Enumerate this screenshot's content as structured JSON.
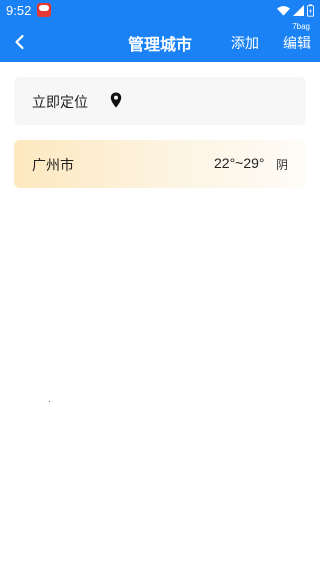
{
  "status_bar": {
    "time": "9:52"
  },
  "badge": "7bag",
  "header": {
    "title": "管理城市",
    "add_label": "添加",
    "edit_label": "编辑"
  },
  "locate": {
    "label": "立即定位"
  },
  "cities": [
    {
      "name": "广州市",
      "temp": "22°~29°",
      "weather": "阴"
    }
  ],
  "colors": {
    "header_bg": "#1a82f5",
    "card_bg": "#f7f7f7",
    "city_card_gradient_start": "#fde8bf"
  }
}
